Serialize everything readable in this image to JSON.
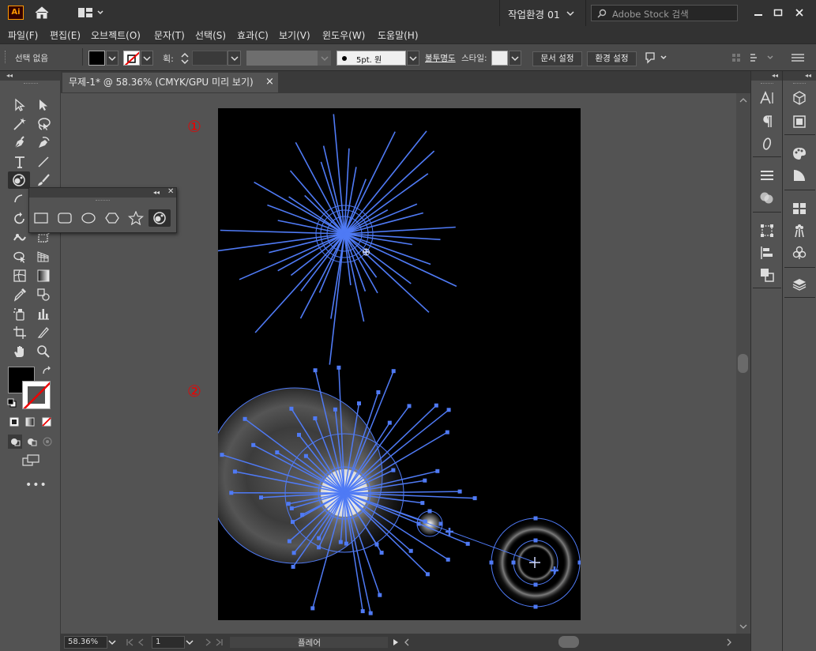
{
  "app": {
    "logo": "Ai",
    "workspace": "작업환경 01",
    "search_placeholder": "Adobe Stock 검색"
  },
  "menu": [
    "파일(F)",
    "편집(E)",
    "오브젝트(O)",
    "문자(T)",
    "선택(S)",
    "효과(C)",
    "보기(V)",
    "윈도우(W)",
    "도움말(H)"
  ],
  "control": {
    "selection_status": "선택 없음",
    "stroke_label": "획:",
    "brush_label": "5pt. 원",
    "opacity_label": "불투명도",
    "style_label": "스타일:",
    "doc_setup": "문서 설정",
    "preferences": "환경 설정"
  },
  "document": {
    "tab_title": "무제-1* @ 58.36% (CMYK/GPU 미리 보기)",
    "tab_close": "×"
  },
  "markers": {
    "one": "①",
    "two": "②"
  },
  "status": {
    "zoom": "58.36%",
    "artboard_num": "1",
    "tool_name": "플레어"
  },
  "colors": {
    "selection": "#4f7af5",
    "artboard": "#000000",
    "marker": "#e00000"
  },
  "flyout_tools": [
    "rectangle-tool",
    "rounded-rectangle-tool",
    "ellipse-tool",
    "polygon-tool",
    "star-tool",
    "flare-tool"
  ]
}
